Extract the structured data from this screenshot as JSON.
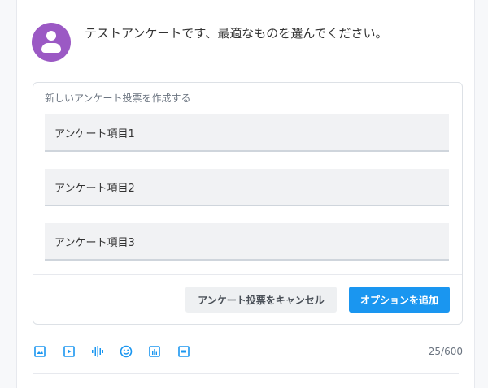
{
  "post": {
    "question": "テストアンケートです、最適なものを選んでください。"
  },
  "poll": {
    "title": "新しいアンケート投票を作成する",
    "options": [
      "アンケート項目1",
      "アンケート項目2",
      "アンケート項目3"
    ],
    "cancel_label": "アンケート投票をキャンセル",
    "add_option_label": "オプションを追加"
  },
  "toolbar": {
    "icons": [
      "image-icon",
      "video-icon",
      "audio-icon",
      "emoji-icon",
      "poll-icon",
      "gif-icon"
    ],
    "char_count": "25/600"
  },
  "colors": {
    "accent": "#1a96f0",
    "avatar": "#9b59c4"
  }
}
